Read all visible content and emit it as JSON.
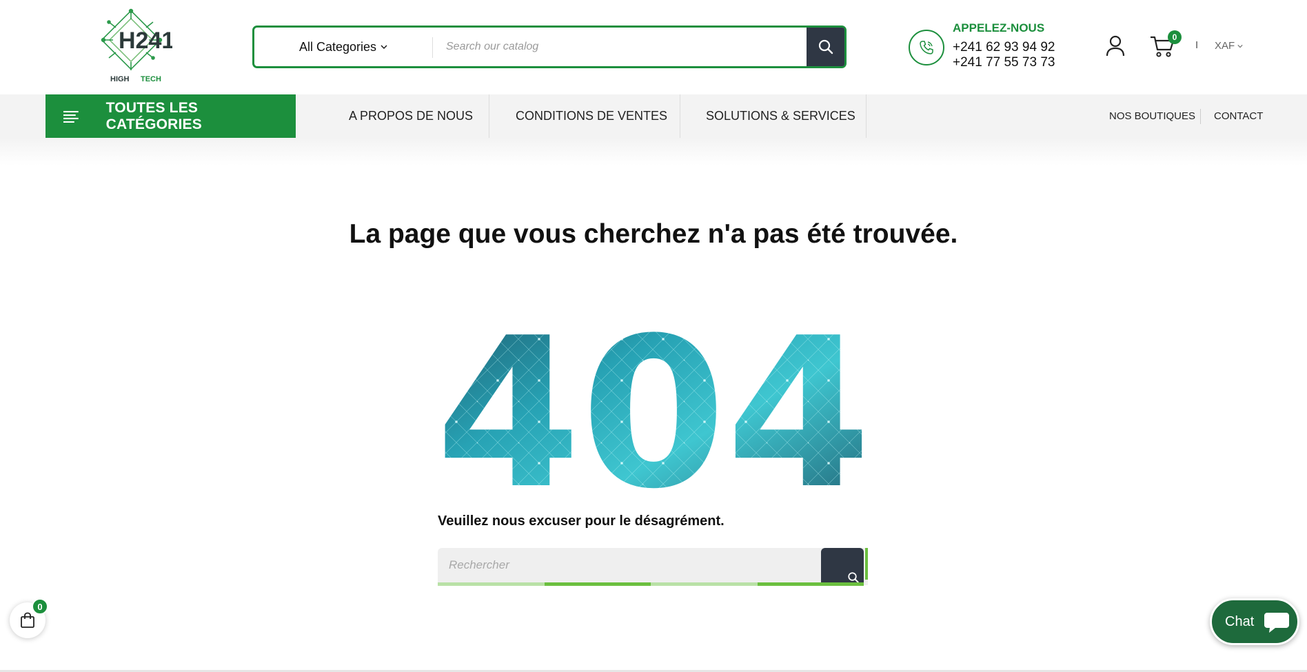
{
  "header": {
    "logo": {
      "text_main": "H241",
      "text_sub_left": "HIGH",
      "text_sub_right": "TECH"
    },
    "search": {
      "category_label": "All Categories",
      "placeholder": "Search our catalog"
    },
    "call": {
      "title": "APPELEZ-NOUS",
      "phone1": "+241 62 93 94 92",
      "phone2": "+241 77 55 73 73"
    },
    "cart_count": "0",
    "separator": "I",
    "currency": "XAF"
  },
  "nav": {
    "all_categories": "TOUTES LES CATÉGORIES",
    "links": [
      "A PROPOS DE NOUS",
      "CONDITIONS DE VENTES",
      "SOLUTIONS & SERVICES"
    ],
    "right_links": [
      "NOS BOUTIQUES",
      "CONTACT"
    ]
  },
  "main": {
    "title": "La page que vous cherchez n'a pas été trouvée.",
    "big_code": "404",
    "apology": "Veuillez nous excuser pour le désagrément.",
    "search_placeholder": "Rechercher"
  },
  "floating": {
    "cart_count": "0",
    "chat_label": "Chat"
  },
  "colors": {
    "brand_green": "#1c8f3d",
    "dark_button": "#2f3744",
    "chat_green": "#1e6a3c",
    "teal_light": "#3fc6d0",
    "teal_dark": "#1d5568"
  },
  "icons": [
    "search-icon",
    "chevron-down-icon",
    "phone-icon",
    "user-icon",
    "cart-icon",
    "menu-icon",
    "shopping-bag-icon",
    "chat-bubble-icon"
  ]
}
